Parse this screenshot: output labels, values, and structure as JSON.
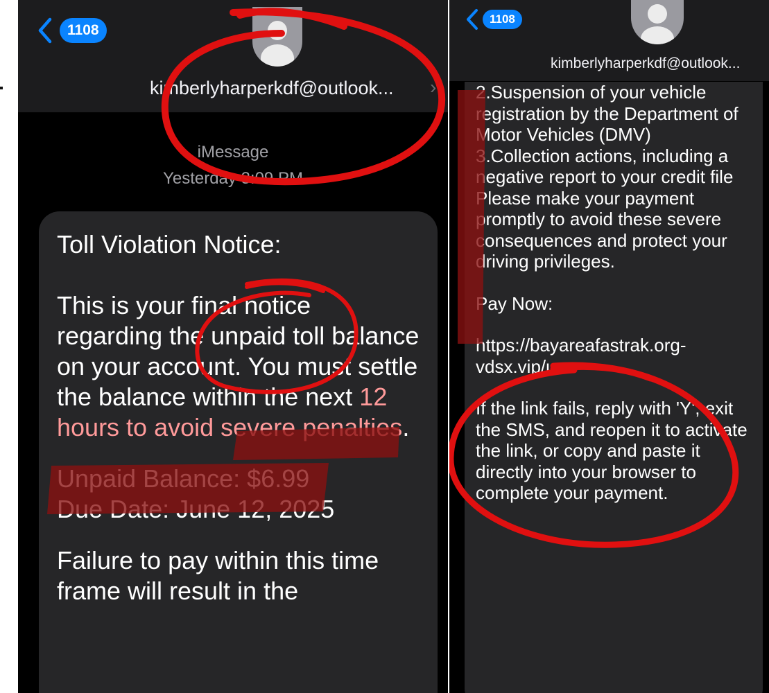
{
  "left_screen": {
    "back_count": "1108",
    "sender": "kimberlyharperkdf@outlook...",
    "service_label": "iMessage",
    "timestamp": "Yesterday 3:09 PM",
    "message": {
      "title": "Toll Violation Notice:",
      "line1": "This is your final notice regarding the unpaid toll balance on your account. You must settle the balance within the next ",
      "highlight": "12 hours to avoid severe penalties",
      "line1_end": ".",
      "balance": "Unpaid Balance: $6.99",
      "due": "Due Date: June 12, 2025",
      "failure": "Failure to pay within this time frame will result in the"
    }
  },
  "right_screen": {
    "back_count": "1108",
    "sender": "kimberlyharperkdf@outlook...",
    "message": {
      "item2": "2.Suspension of your vehicle registration by the Department of Motor Vehicles (DMV)",
      "item3": "3.Collection actions, including a negative report to your credit file",
      "urge": "Please make your payment promptly to avoid these severe consequences and protect your driving privileges.",
      "pay_label": "Pay Now:",
      "link": "https://bayareafastrak.org-vdsx.vip/us",
      "instructions": "If the link fails, reply with 'Y', exit the SMS, and reopen it to activate the link, or copy and paste it directly into your browser to complete your payment."
    }
  },
  "colors": {
    "accent": "#0a84ff",
    "annotation_red": "#e01010",
    "highlight_red": "#8b1111"
  }
}
